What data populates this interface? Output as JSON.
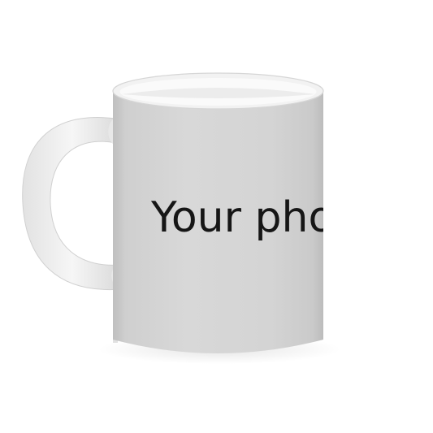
{
  "product": {
    "print_text": "Your photo"
  },
  "colors": {
    "background": "#ffffff",
    "mug_body": "#d5d5d5",
    "mug_rim": "#f4f4f4",
    "handle": "#ececec",
    "text": "#161616"
  }
}
